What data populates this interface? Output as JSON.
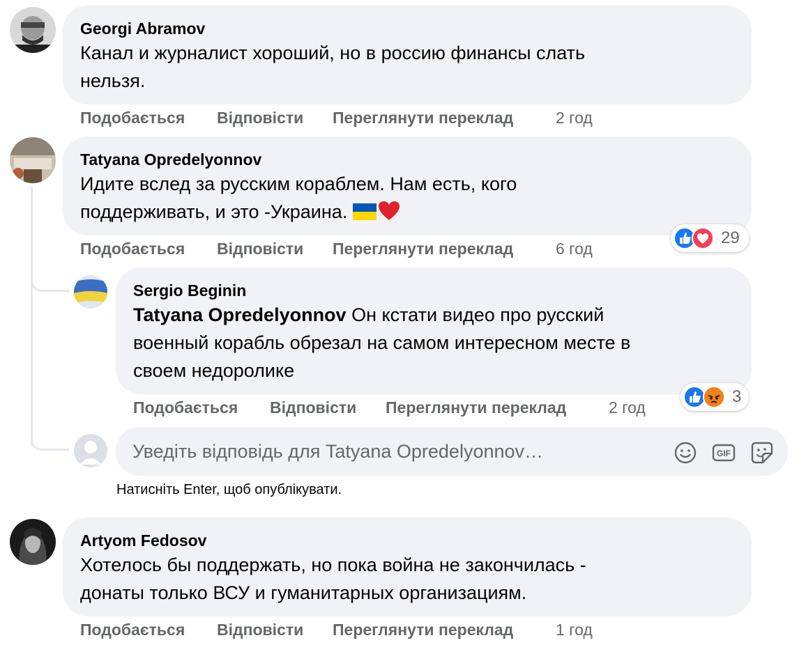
{
  "comments": [
    {
      "author": "Georgi Abramov",
      "text_line1": "Канал и журналист хороший, но в россию финансы слать",
      "text_line2": "нельзя.",
      "actions": {
        "like": "Подобається",
        "reply": "Відповісти",
        "translate": "Переглянути переклад",
        "time": "2 год"
      }
    },
    {
      "author": "Tatyana Opredelyonnov",
      "text_line1": "Идите вслед за русским кораблем. Нам есть, кого",
      "text_line2": "поддерживать, и это -Украина. ",
      "emojis": [
        "ukraine-flag",
        "red-heart"
      ],
      "reactions": {
        "icons": [
          "like",
          "love"
        ],
        "count": "29"
      },
      "actions": {
        "like": "Подобається",
        "reply": "Відповісти",
        "translate": "Переглянути переклад",
        "time": "6 год"
      }
    }
  ],
  "reply": {
    "author": "Sergio Beginin",
    "mention": "Tatyana Opredelyonnov",
    "text_line1_rest": " Он кстати видео про русский",
    "text_line2": "военный корабль обрезал на самом интересном месте в",
    "text_line3": "своем недоролике",
    "reactions": {
      "icons": [
        "like",
        "angry"
      ],
      "count": "3"
    },
    "actions": {
      "like": "Подобається",
      "reply": "Відповісти",
      "translate": "Переглянути переклад",
      "time": "2 год"
    }
  },
  "reply_box": {
    "placeholder": "Уведіть відповідь для Tatyana Opredelyonnov…",
    "hint": "Натисніть Enter, щоб опублікувати.",
    "icons": [
      "emoji-icon",
      "gif-icon",
      "sticker-icon"
    ]
  },
  "last_comment": {
    "author": "Artyom Fedosov",
    "text_line1": "Хотелось бы поддержать, но пока война не закончилась -",
    "text_line2": "донаты только ВСУ и гуманитарных организациям.",
    "actions": {
      "like": "Подобається",
      "reply": "Відповісти",
      "translate": "Переглянути переклад",
      "time": "1 год"
    }
  },
  "colors": {
    "bubble": "#f0f2f5",
    "secondary_text": "#65676b",
    "like_blue": "#1877f2",
    "love_red": "#f33e58",
    "thread_line": "#e4e6eb"
  }
}
